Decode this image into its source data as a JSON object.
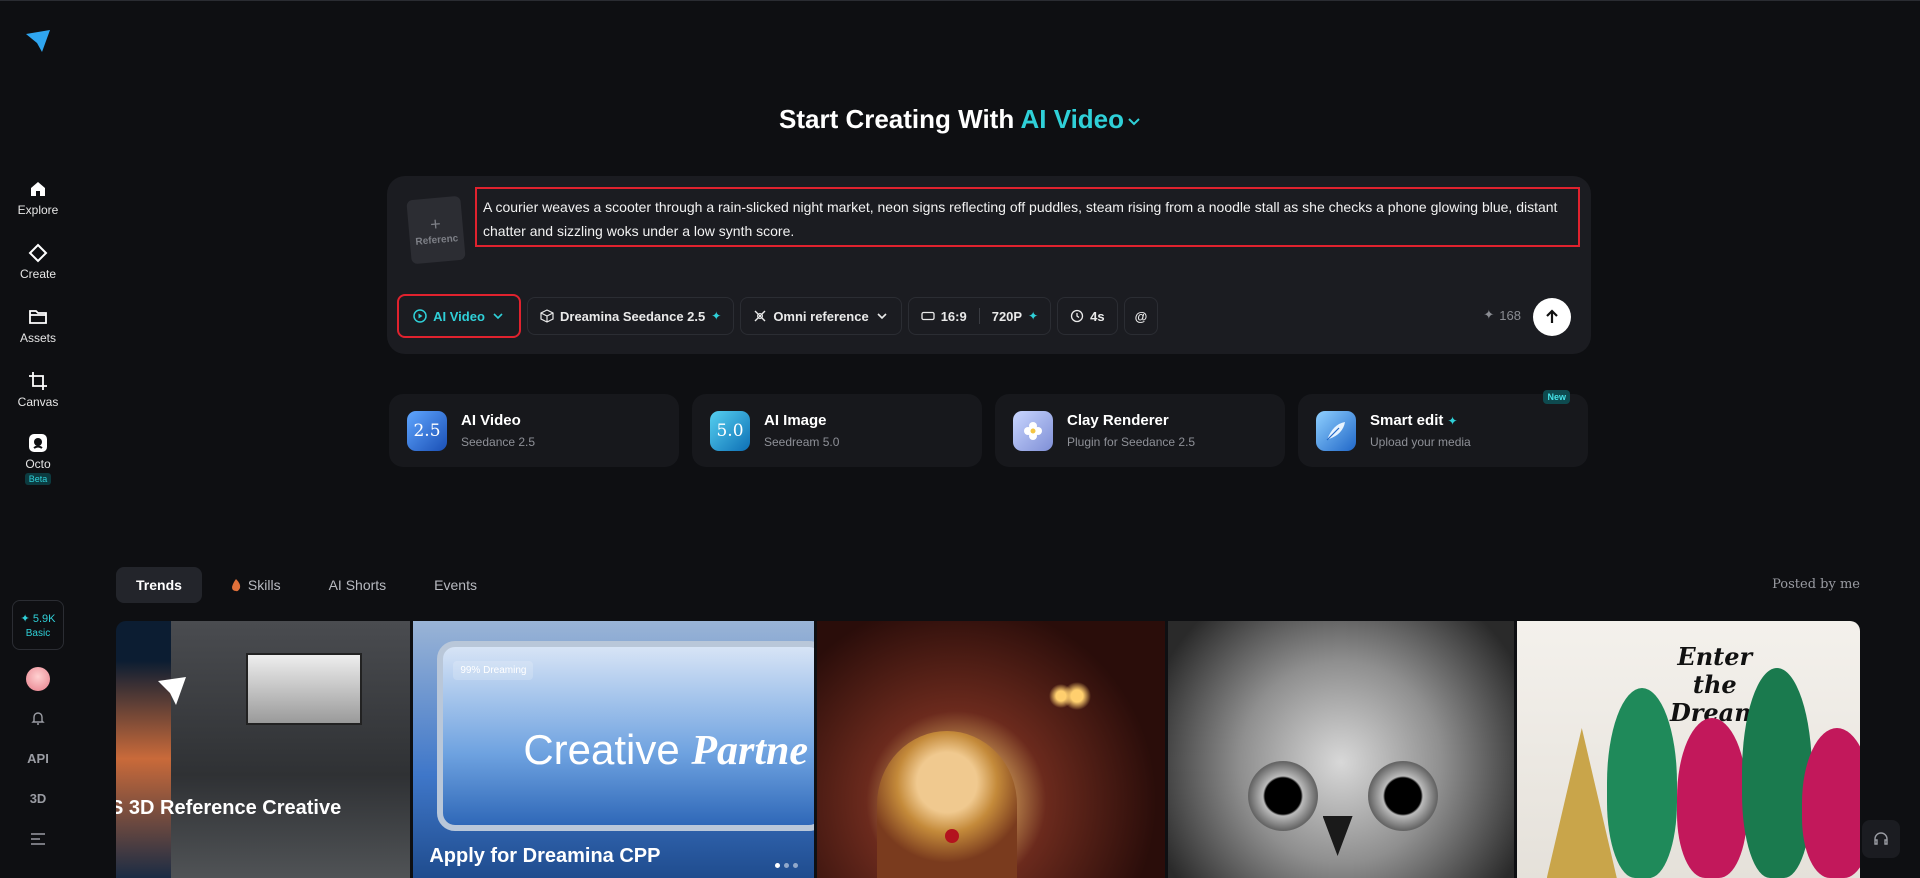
{
  "sidebar": {
    "nav": [
      {
        "label": "Explore",
        "icon": "home-icon"
      },
      {
        "label": "Create",
        "icon": "diamond-icon"
      },
      {
        "label": "Assets",
        "icon": "folder-icon"
      },
      {
        "label": "Canvas",
        "icon": "crop-icon"
      },
      {
        "label": "Octo",
        "icon": "octo-icon",
        "badge": "Beta"
      }
    ],
    "credits": {
      "value": "✦ 5.9K",
      "tier": "Basic"
    },
    "api_label": "API",
    "threed_label": "3D"
  },
  "hero": {
    "prefix": "Start Creating With",
    "mode": "AI Video"
  },
  "prompt": {
    "reference_label": "Referenc",
    "text": "A courier weaves a scooter through a rain-slicked night market, neon signs reflecting off puddles, steam rising from a noodle stall as she checks a phone glowing blue, distant chatter and sizzling woks under a low synth score."
  },
  "toolbar": {
    "mode": "AI Video",
    "model": "Dreamina Seedance 2.5",
    "reference": "Omni reference",
    "ratio": "16:9",
    "resolution": "720P",
    "duration": "4s",
    "mention": "@",
    "credits": "168"
  },
  "features": [
    {
      "title": "AI Video",
      "subtitle": "Seedance 2.5",
      "icon_text": "2.5",
      "color": "#2f6fd6"
    },
    {
      "title": "AI Image",
      "subtitle": "Seedream 5.0",
      "icon_text": "5.0",
      "color": "#1a8fd0"
    },
    {
      "title": "Clay Renderer",
      "subtitle": "Plugin for Seedance 2.5",
      "icon_text": "",
      "color": "#6f86c8"
    },
    {
      "title": "Smart edit",
      "subtitle": "Upload your media",
      "icon_text": "",
      "color": "#3d8be0",
      "badge": "New"
    }
  ],
  "tabs": [
    {
      "label": "Trends"
    },
    {
      "label": "Skills"
    },
    {
      "label": "AI Shorts"
    },
    {
      "label": "Events"
    }
  ],
  "posted_by": "Posted by me",
  "gallery": [
    {
      "caption": "S 3D Reference Creative"
    },
    {
      "caption": "Apply for Dreamina CPP",
      "pill": "99% Dreaming",
      "headline_a": "Creative",
      "headline_b": "Partne"
    },
    {
      "caption": ""
    },
    {
      "caption": ""
    },
    {
      "caption": "",
      "headline": "Enter the Dream"
    }
  ],
  "colors": {
    "accent": "#2fd0d8",
    "highlight": "#e0222e",
    "background": "#0e0f12"
  }
}
